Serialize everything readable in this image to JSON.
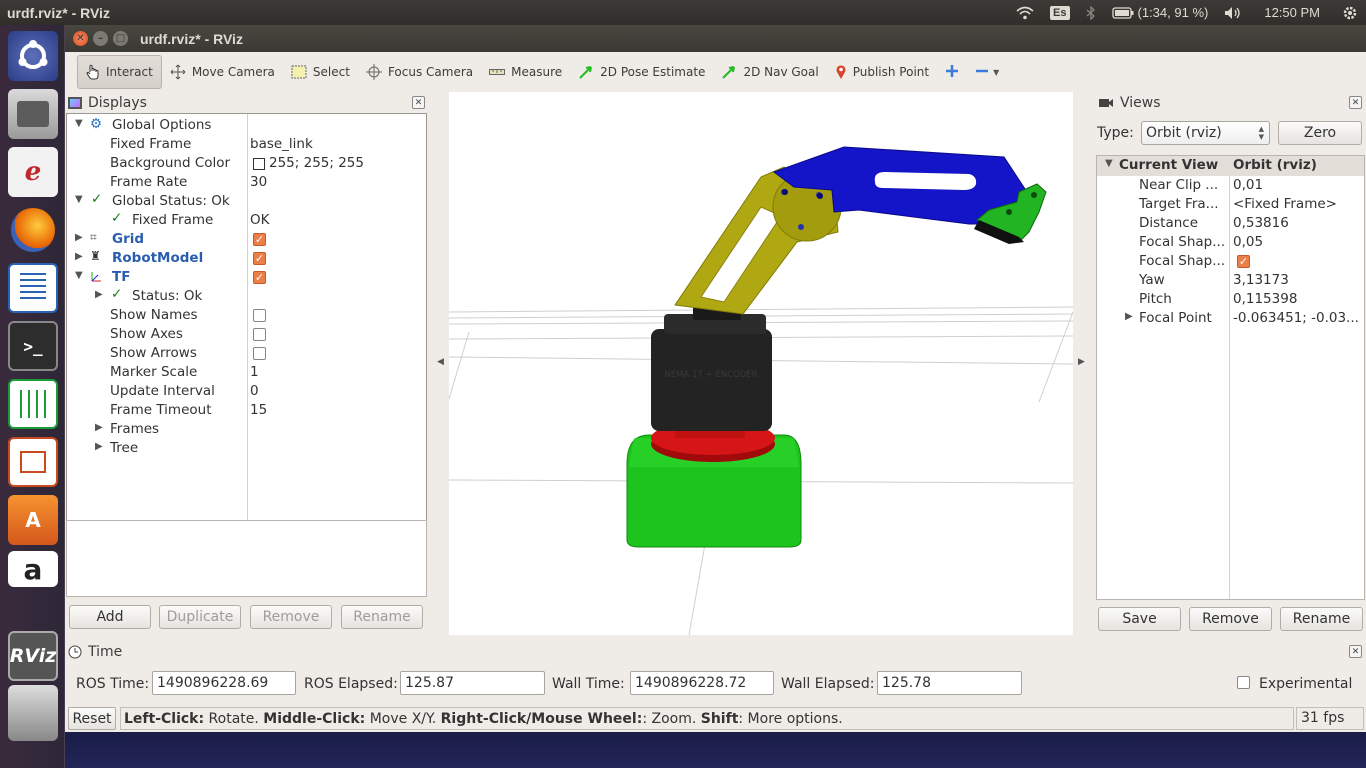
{
  "topbar": {
    "window_title": "urdf.rviz* - RViz",
    "keyboard_layout": "Es",
    "battery_text": "(1:34, 91 %)",
    "clock": "12:50 PM"
  },
  "window": {
    "title": "urdf.rviz* - RViz"
  },
  "toolbar": {
    "tools": [
      {
        "label": "Interact",
        "icon": "hand-pointer-icon"
      },
      {
        "label": "Move Camera",
        "icon": "move-camera-icon"
      },
      {
        "label": "Select",
        "icon": "select-rect-icon"
      },
      {
        "label": "Focus Camera",
        "icon": "focus-camera-icon"
      },
      {
        "label": "Measure",
        "icon": "ruler-icon"
      },
      {
        "label": "2D Pose Estimate",
        "icon": "green-arrow-icon"
      },
      {
        "label": "2D Nav Goal",
        "icon": "green-arrow-icon"
      },
      {
        "label": "Publish Point",
        "icon": "map-pin-icon"
      }
    ]
  },
  "displays": {
    "title": "Displays",
    "rows": {
      "global_options": "Global Options",
      "fixed_frame_k": "Fixed Frame",
      "fixed_frame_v": "base_link",
      "bg_color_k": "Background Color",
      "bg_color_v": "255; 255; 255",
      "frame_rate_k": "Frame Rate",
      "frame_rate_v": "30",
      "global_status": "Global Status: Ok",
      "fixed_frame_status_k": "Fixed Frame",
      "fixed_frame_status_v": "OK",
      "grid": "Grid",
      "robot_model": "RobotModel",
      "tf": "TF",
      "status_ok": "Status: Ok",
      "show_names": "Show Names",
      "show_axes": "Show Axes",
      "show_arrows": "Show Arrows",
      "marker_scale_k": "Marker Scale",
      "marker_scale_v": "1",
      "update_interval_k": "Update Interval",
      "update_interval_v": "0",
      "frame_timeout_k": "Frame Timeout",
      "frame_timeout_v": "15",
      "frames": "Frames",
      "tree": "Tree"
    },
    "buttons": {
      "add": "Add",
      "duplicate": "Duplicate",
      "remove": "Remove",
      "rename": "Rename"
    }
  },
  "views": {
    "title": "Views",
    "type_label": "Type:",
    "type_value": "Orbit (rviz)",
    "zero": "Zero",
    "header_k": "Current View",
    "header_v": "Orbit (rviz)",
    "rows": [
      {
        "k": "Near Clip ...",
        "v": "0,01"
      },
      {
        "k": "Target Fra...",
        "v": "<Fixed Frame>"
      },
      {
        "k": "Distance",
        "v": "0,53816"
      },
      {
        "k": "Focal Shap...",
        "v": "0,05"
      },
      {
        "k": "Focal Shap...",
        "v": ""
      },
      {
        "k": "Yaw",
        "v": "3,13173"
      },
      {
        "k": "Pitch",
        "v": "0,115398"
      },
      {
        "k": "Focal Point",
        "v": "-0.063451; -0.03..."
      }
    ],
    "buttons": {
      "save": "Save",
      "remove": "Remove",
      "rename": "Rename"
    }
  },
  "time": {
    "title": "Time",
    "ros_time_label": "ROS Time:",
    "ros_time": "1490896228.69",
    "ros_elapsed_label": "ROS Elapsed:",
    "ros_elapsed": "125.87",
    "wall_time_label": "Wall Time:",
    "wall_time": "1490896228.72",
    "wall_elapsed_label": "Wall Elapsed:",
    "wall_elapsed": "125.78",
    "experimental": "Experimental"
  },
  "statusbar": {
    "reset": "Reset",
    "left_click": "Left-Click:",
    "rotate": " Rotate. ",
    "middle_click": "Middle-Click:",
    "move": " Move X/Y. ",
    "right_click": "Right-Click/Mouse Wheel:",
    "zoom": ": Zoom. ",
    "shift": "Shift",
    "more": ": More options.",
    "fps": "31 fps"
  },
  "robot": {
    "base_label": "NEMA 17 + ENCODER"
  },
  "colors": {
    "accent_orange": "#ec7e4a",
    "robot_base": "#1ec41e",
    "robot_arm": "#b0a812",
    "robot_link": "#1414c8"
  }
}
